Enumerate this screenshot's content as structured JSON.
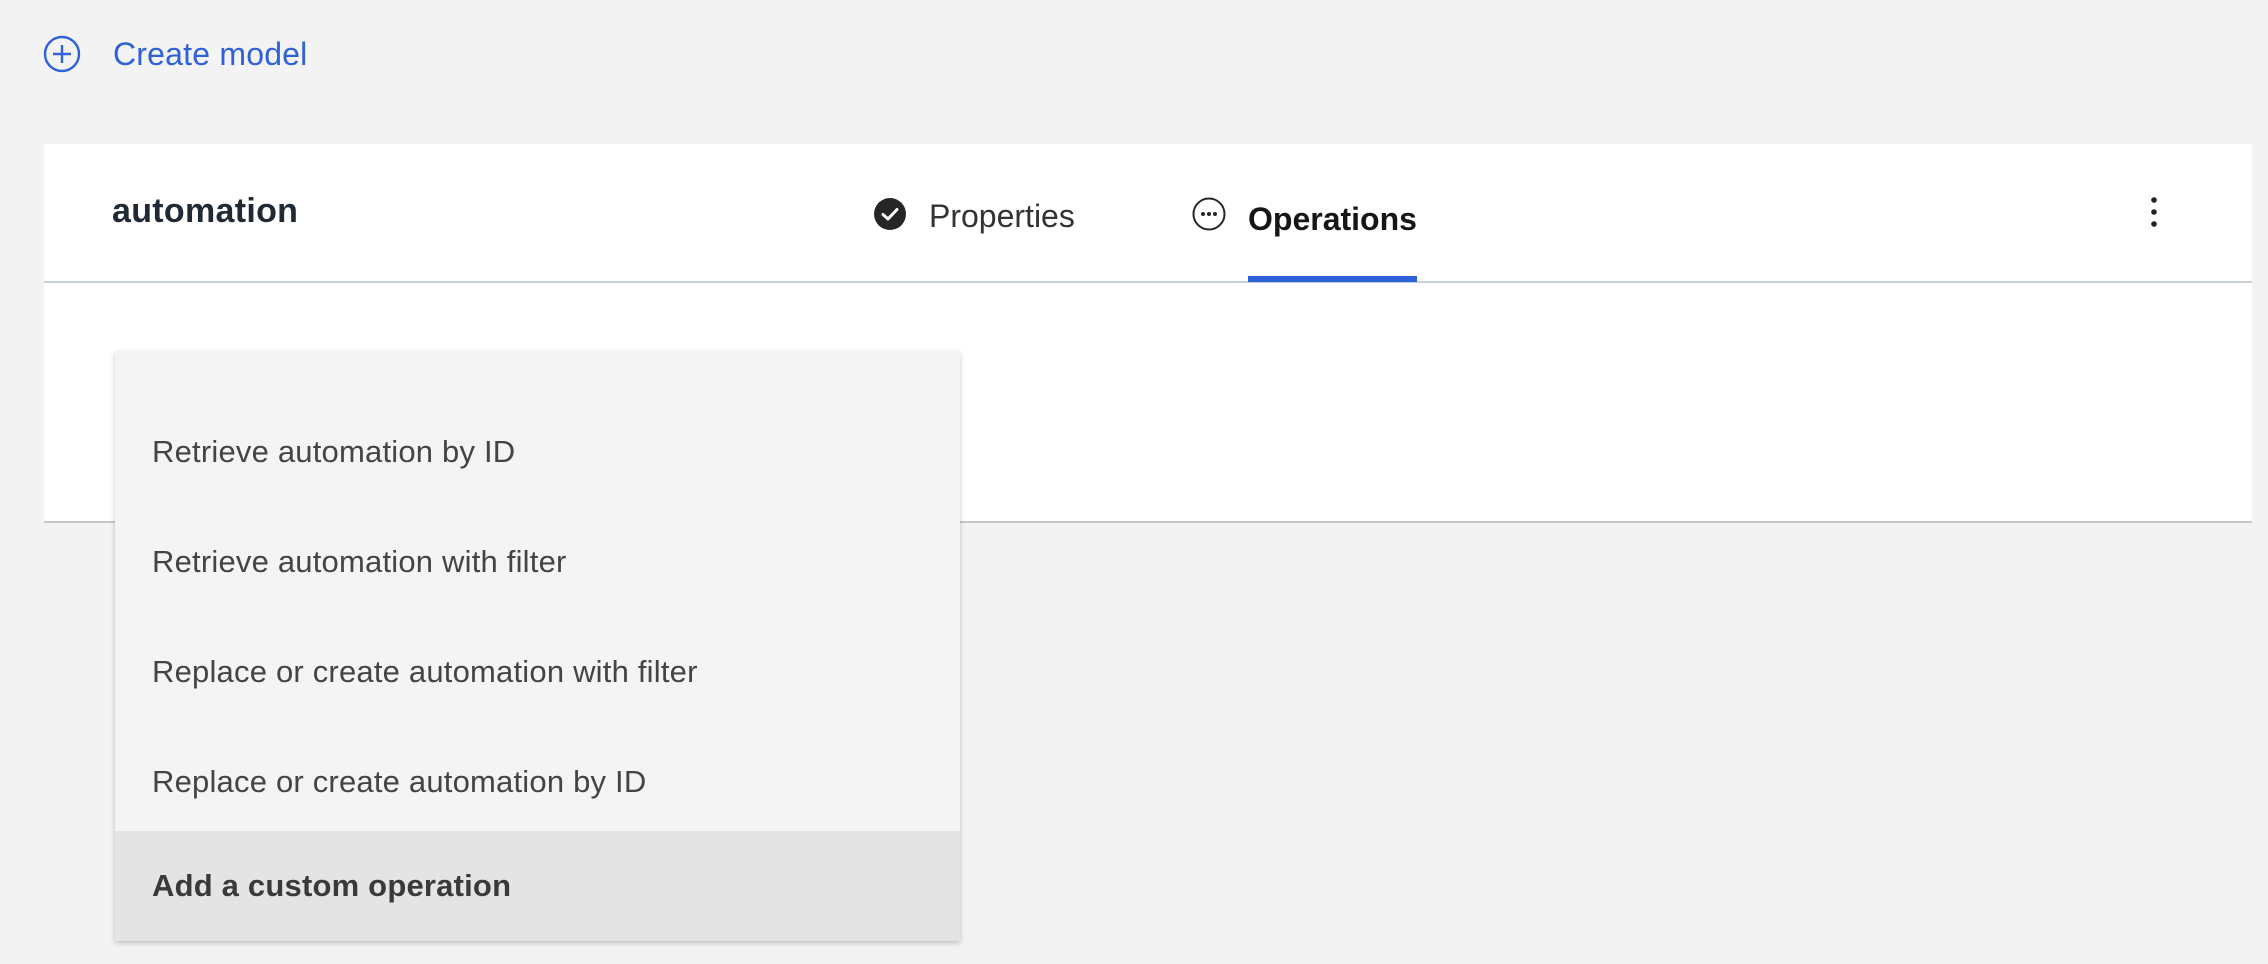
{
  "header": {
    "create_model_label": "Create model",
    "create_model_icon": "add-circle-icon"
  },
  "card": {
    "model_name": "automation",
    "tabs": [
      {
        "label": "Properties",
        "icon": "checkmark-filled-icon",
        "status": "complete",
        "active": false
      },
      {
        "label": "Operations",
        "icon": "more-circle-icon",
        "status": "in-progress",
        "active": true
      }
    ],
    "overflow_icon": "overflow-menu-vertical-icon"
  },
  "dropdown": {
    "items": [
      {
        "label": "Retrieve automation by ID",
        "highlighted": false
      },
      {
        "label": "Retrieve automation with filter",
        "highlighted": false
      },
      {
        "label": "Replace or create automation with filter",
        "highlighted": false
      },
      {
        "label": "Replace or create automation by ID",
        "highlighted": false
      },
      {
        "label": "Add a custom operation",
        "highlighted": true
      }
    ]
  },
  "colors": {
    "accent": "#2f62d8",
    "background": "#f3f3f3",
    "card": "#ffffff",
    "menu": "#f4f4f4",
    "menu_highlight": "#e4e4e4"
  }
}
